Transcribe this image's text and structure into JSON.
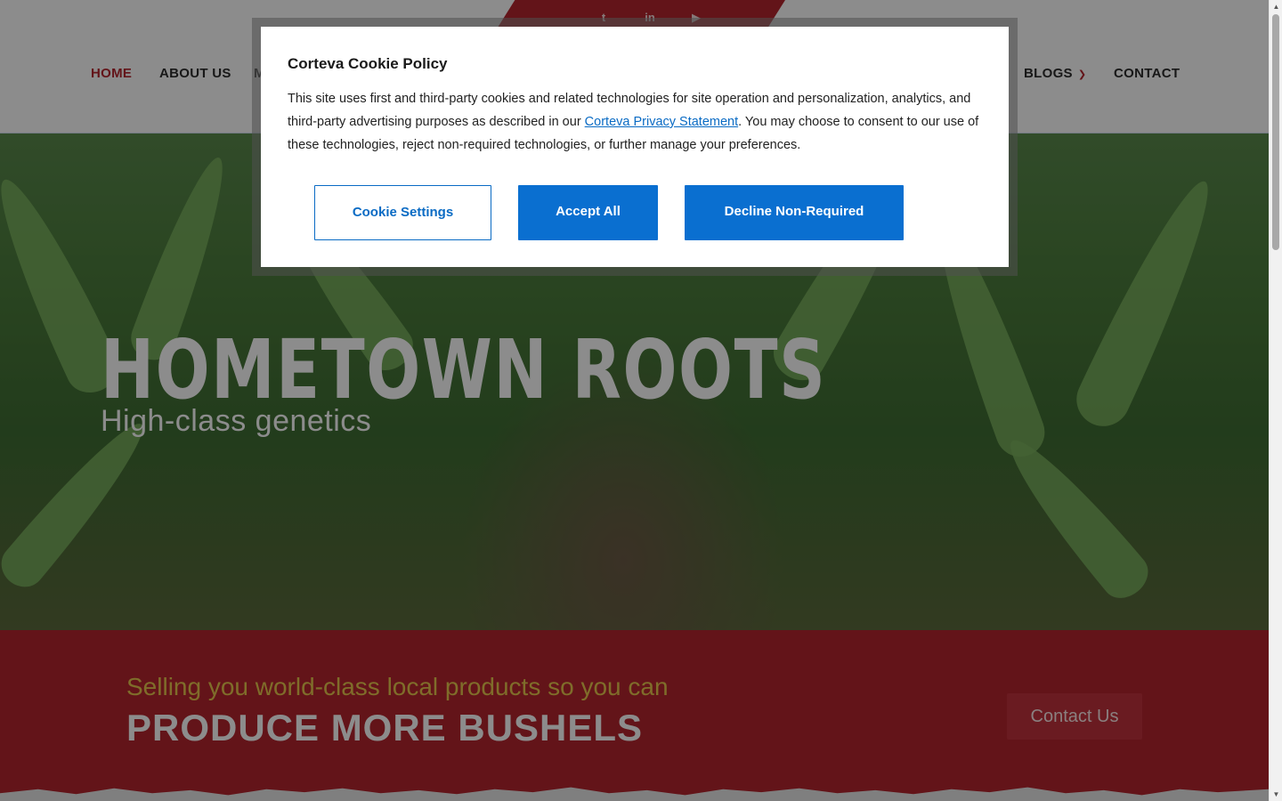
{
  "header": {
    "social": [
      {
        "name": "twitter",
        "glyph": "t"
      },
      {
        "name": "linkedin",
        "glyph": "in"
      },
      {
        "name": "youtube",
        "glyph": "▶"
      }
    ],
    "nav": [
      {
        "label": "HOME",
        "active": true,
        "dropdown": false
      },
      {
        "label": "ABOUT US",
        "active": false,
        "dropdown": false
      },
      {
        "label": "M",
        "active": false,
        "dropdown": false
      },
      {
        "label": "BLOGS",
        "active": false,
        "dropdown": true
      },
      {
        "label": "CONTACT",
        "active": false,
        "dropdown": false
      }
    ]
  },
  "hero": {
    "title": "HOMETOWN ROOTS",
    "subtitle": "High-class genetics"
  },
  "banner": {
    "tagline": "Selling you world-class local products so you can",
    "headline": "PRODUCE MORE BUSHELS",
    "button_label": "Contact Us"
  },
  "cookie_modal": {
    "title": "Corteva Cookie Policy",
    "body_before_link": "This site uses first and third-party cookies and related technologies for site operation and personalization, analytics, and third-party advertising purposes as described in our ",
    "link_text": "Corteva Privacy Statement",
    "body_after_link": ". You may choose to consent to our use of these technologies, reject non-required technologies, or further manage your preferences.",
    "buttons": {
      "settings": "Cookie Settings",
      "accept": "Accept All",
      "decline": "Decline Non-Required"
    }
  },
  "colors": {
    "brand_red": "#b5262f",
    "accent_gold": "#e8c64d",
    "button_blue": "#0a6fd0"
  }
}
